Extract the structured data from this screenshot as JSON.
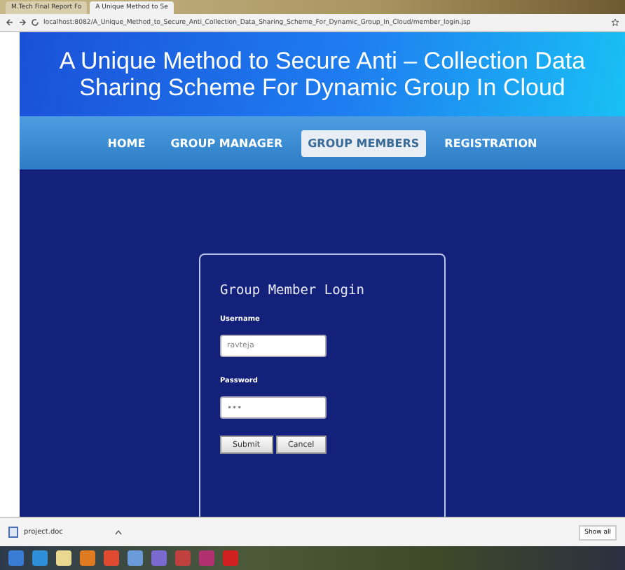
{
  "browser": {
    "tabs": [
      {
        "label": "M.Tech Final Report Fo",
        "selected": false
      },
      {
        "label": "A Unique Method to Se",
        "selected": true
      }
    ],
    "url": "localhost:8082/A_Unique_Method_to_Secure_Anti_Collection_Data_Sharing_Scheme_For_Dynamic_Group_In_Cloud/member_login.jsp"
  },
  "header": {
    "title": "A Unique Method to Secure Anti – Collection Data Sharing Scheme For Dynamic Group In Cloud"
  },
  "nav": [
    {
      "label": "HOME",
      "selected": false
    },
    {
      "label": "GROUP MANAGER",
      "selected": false
    },
    {
      "label": "GROUP MEMBERS",
      "selected": true
    },
    {
      "label": "REGISTRATION",
      "selected": false
    }
  ],
  "login": {
    "title": "Group Member Login",
    "fields": [
      {
        "label": "Username",
        "value": "ravteja",
        "kind": "text"
      },
      {
        "label": "Password",
        "value": "•••",
        "kind": "password"
      }
    ],
    "buttons": [
      "Submit",
      "Cancel"
    ]
  },
  "downloads": {
    "file": "project.doc",
    "show_all": "Show all"
  }
}
